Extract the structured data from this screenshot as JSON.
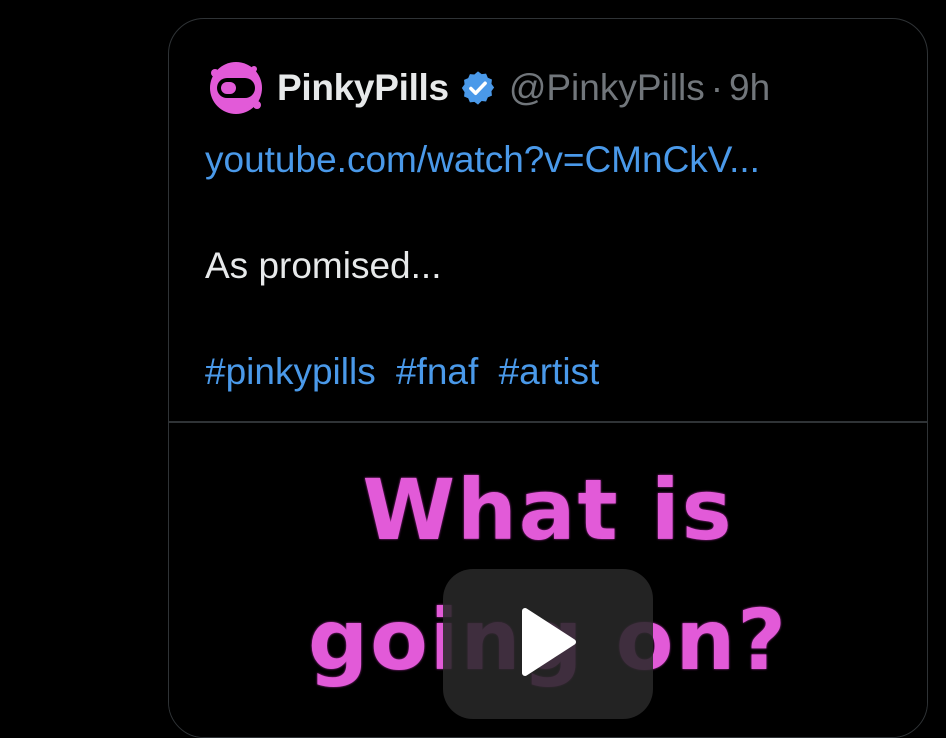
{
  "tweet": {
    "display_name": "PinkyPills",
    "handle": "@PinkyPills",
    "separator": "·",
    "time": "9h",
    "link": "youtube.com/watch?v=CMnCkV...",
    "text": "As promised...",
    "hashtags": [
      "#pinkypills",
      "#fnaf",
      "#artist"
    ],
    "avatar_icon": "pill-logo-icon",
    "verified_icon": "verified-badge-icon",
    "accent_color": "#4a99e9",
    "brand_color": "#e25ad8"
  },
  "video": {
    "thumbnail_line1": "What is",
    "thumbnail_line2": "going on?",
    "play_icon": "play-icon"
  }
}
